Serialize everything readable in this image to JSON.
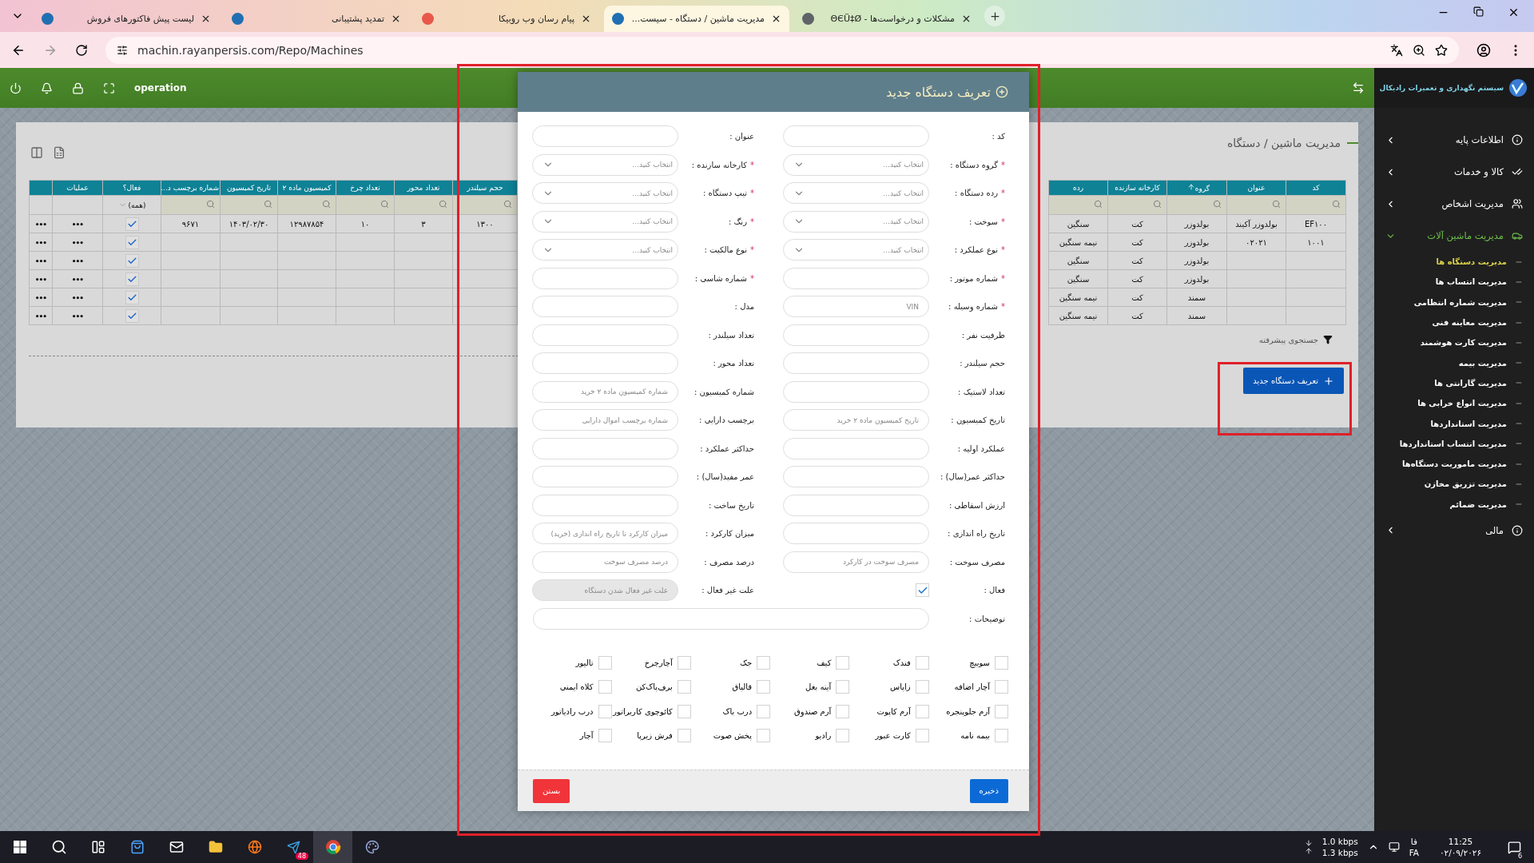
{
  "browser": {
    "tabs": [
      {
        "title": "مشکلات و درخواست‌ها - ΘЄÜ‡Ø",
        "selected": false,
        "color": "#5f6368"
      },
      {
        "title": "مدیریت ماشین / دستگاه - سیست...",
        "selected": true,
        "color": "#1f6fb2"
      },
      {
        "title": "پیام رسان وب روبیکا",
        "selected": false,
        "color": "#e8574a"
      },
      {
        "title": "تمدید پشتیبانی",
        "selected": false,
        "color": "#1f6fb2"
      },
      {
        "title": "لیست پیش فاکتورهای فروش",
        "selected": false,
        "color": "#1f6fb2"
      }
    ],
    "url": "machin.rayanpersis.com/Repo/Machines"
  },
  "header": {
    "user": "operation"
  },
  "sidebar": {
    "title": "سیستم نگهداری و تعمیرات رادیکال",
    "items": [
      {
        "label": "اطلاعات پایه",
        "expanded": false
      },
      {
        "label": "کالا و خدمات",
        "expanded": false
      },
      {
        "label": "مدیریت اشخاص",
        "expanded": false
      },
      {
        "label": "مدیریت ماشین آلات",
        "expanded": true,
        "children": [
          {
            "label": "مدیریت دستگاه ها",
            "selected": true
          },
          {
            "label": "مدیریت انتساب ها",
            "selected": false
          },
          {
            "label": "مدیریت شماره انتظامی",
            "selected": false
          },
          {
            "label": "مدیریت معاینه فنی",
            "selected": false
          },
          {
            "label": "مدیریت کارت هوشمند",
            "selected": false
          },
          {
            "label": "مدیریت بیمه",
            "selected": false
          },
          {
            "label": "مدیریت گارانتی ها",
            "selected": false
          },
          {
            "label": "مدیریت انواع خرابی ها",
            "selected": false
          },
          {
            "label": "مدیریت استانداردها",
            "selected": false
          },
          {
            "label": "مدیریت انتساب استانداردها",
            "selected": false
          },
          {
            "label": "مدیریت ماموریت دستگاه‌ها",
            "selected": false
          },
          {
            "label": "مدیریت تزریق مخازن",
            "selected": false
          },
          {
            "label": "مدیریت ضمائم",
            "selected": false
          }
        ]
      },
      {
        "label": "مالی",
        "expanded": false
      }
    ]
  },
  "page": {
    "breadcrumb": "مدیریت ماشین / دستگاه",
    "advanced_search": "جستجوی پیشرفته",
    "new_button": "تعریف دستگاه جدید"
  },
  "table": {
    "right_columns": [
      {
        "label": "کد",
        "sorted": false
      },
      {
        "label": "عنوان",
        "sorted": false
      },
      {
        "label": "گروه",
        "sorted": true
      },
      {
        "label": "کارخانه سازنده",
        "sorted": false
      },
      {
        "label": "رده",
        "sorted": false
      }
    ],
    "right_rows": [
      [
        "EF۱۰۰",
        "بولدوزر آکیند",
        "بولدوزر",
        "کت",
        "سنگین"
      ],
      [
        "۱۰۰۱",
        "۰۲۰۲۱",
        "بولدوزر",
        "کت",
        "نیمه سنگین"
      ],
      [
        null,
        null,
        "بولدوزر",
        "کت",
        "سنگین"
      ],
      [
        null,
        null,
        "بولدوزر",
        "کت",
        "سنگین"
      ],
      [
        null,
        null,
        "سمند",
        "کت",
        "نیمه سنگین"
      ],
      [
        null,
        null,
        "سمند",
        "کت",
        "نیمه سنگین"
      ]
    ],
    "left_columns": [
      "حجم سیلندر",
      "تعداد محور",
      "تعداد چرخ",
      "کمیسیون ماده ۲",
      "تاریخ کمیسیون",
      "شماره برچسب د..."
    ],
    "active_column": "فعال؟",
    "active_filter": "(همه)",
    "actions_column": "عملیات",
    "left_rows": [
      {
        "cells": [
          "۱۳۰۰",
          "۳",
          "۱۰",
          "۱۲۹۸۷۸۵۴",
          "۱۴۰۳/۰۲/۳۰",
          "۹۶۷۱"
        ],
        "active": true,
        "actions": "•••",
        "menu": "•••"
      },
      {
        "cells": [
          null,
          null,
          null,
          null,
          null,
          null
        ],
        "active": true,
        "actions": "•••",
        "menu": "•••"
      },
      {
        "cells": [
          null,
          null,
          null,
          null,
          null,
          null
        ],
        "active": true,
        "actions": "•••",
        "menu": "•••"
      },
      {
        "cells": [
          null,
          null,
          null,
          null,
          null,
          null
        ],
        "active": true,
        "actions": "•••",
        "menu": "•••"
      },
      {
        "cells": [
          null,
          null,
          null,
          null,
          null,
          null
        ],
        "active": true,
        "actions": "•••",
        "menu": "•••"
      },
      {
        "cells": [
          null,
          null,
          null,
          null,
          null,
          null
        ],
        "active": true,
        "actions": "•••",
        "menu": "•••"
      }
    ]
  },
  "modal": {
    "title": "تعریف دستگاه جدید",
    "fields": [
      {
        "label": "کد :",
        "required": false,
        "kind": "text"
      },
      {
        "label": "عنوان :",
        "required": false,
        "kind": "text"
      },
      {
        "label": "گروه دستگاه :",
        "required": true,
        "kind": "select",
        "placeholder": "انتخاب کنید..."
      },
      {
        "label": "کارخانه سازنده :",
        "required": true,
        "kind": "select",
        "placeholder": "انتخاب کنید..."
      },
      {
        "label": "رده دستگاه :",
        "required": true,
        "kind": "select",
        "placeholder": "انتخاب کنید..."
      },
      {
        "label": "تیپ دستگاه :",
        "required": true,
        "kind": "select",
        "placeholder": "انتخاب کنید..."
      },
      {
        "label": "سوخت :",
        "required": true,
        "kind": "select",
        "placeholder": "انتخاب کنید..."
      },
      {
        "label": "رنگ :",
        "required": true,
        "kind": "select",
        "placeholder": "انتخاب کنید..."
      },
      {
        "label": "نوع عملکرد :",
        "required": true,
        "kind": "select",
        "placeholder": "انتخاب کنید..."
      },
      {
        "label": "نوع مالکیت :",
        "required": true,
        "kind": "select",
        "placeholder": "انتخاب کنید..."
      },
      {
        "label": "شماره موتور :",
        "required": true,
        "kind": "text"
      },
      {
        "label": "شماره شاسی :",
        "required": true,
        "kind": "text"
      },
      {
        "label": "شماره وسیله :",
        "required": true,
        "kind": "text",
        "placeholder": "VIN"
      },
      {
        "label": "مدل :",
        "required": false,
        "kind": "text"
      },
      {
        "label": "ظرفیت نفر :",
        "required": false,
        "kind": "text"
      },
      {
        "label": "تعداد سیلندر :",
        "required": false,
        "kind": "text"
      },
      {
        "label": "حجم سیلندر :",
        "required": false,
        "kind": "text"
      },
      {
        "label": "تعداد محور :",
        "required": false,
        "kind": "text"
      },
      {
        "label": "تعداد لاستیک :",
        "required": false,
        "kind": "text"
      },
      {
        "label": "شماره کمیسیون :",
        "required": false,
        "kind": "text",
        "placeholder": "شماره کمیسیون ماده ۲ خرید"
      },
      {
        "label": "تاریخ کمیسیون :",
        "required": false,
        "kind": "text",
        "placeholder": "تاریخ کمیسیون ماده ۲ خرید"
      },
      {
        "label": "برچسب دارایی :",
        "required": false,
        "kind": "text",
        "placeholder": "شماره برچسب اموال دارایی"
      },
      {
        "label": "عملکرد اولیه :",
        "required": false,
        "kind": "text"
      },
      {
        "label": "حداکثر عملکرد :",
        "required": false,
        "kind": "text"
      },
      {
        "label": "حداکثر عمر(سال) :",
        "required": false,
        "kind": "text"
      },
      {
        "label": "عمر مفید(سال) :",
        "required": false,
        "kind": "text"
      },
      {
        "label": "ارزش اسقاطی :",
        "required": false,
        "kind": "text"
      },
      {
        "label": "تاریخ ساخت :",
        "required": false,
        "kind": "text"
      },
      {
        "label": "تاریخ راه اندازی :",
        "required": false,
        "kind": "text"
      },
      {
        "label": "میزان کارکرد :",
        "required": false,
        "kind": "text",
        "placeholder": "میزان کارکرد تا تاریخ راه اندازی (خرید)"
      },
      {
        "label": "مصرف سوخت :",
        "required": false,
        "kind": "text",
        "placeholder": "مصرف سوخت در کارکرد"
      },
      {
        "label": "درصد مصرف :",
        "required": false,
        "kind": "text",
        "placeholder": "درصد مصرف سوخت"
      },
      {
        "label": "فعال :",
        "required": false,
        "kind": "checkbox",
        "checked": true
      },
      {
        "label": "علت غیر فعال :",
        "required": false,
        "kind": "text",
        "placeholder": "علت غیر فعال شدن دستگاه",
        "disabled": true
      },
      {
        "label": "توضیحات :",
        "required": false,
        "kind": "wide"
      }
    ],
    "accessories": [
      {
        "label": "سوییچ",
        "checked": false
      },
      {
        "label": "فندک",
        "checked": false
      },
      {
        "label": "کیف",
        "checked": false
      },
      {
        "label": "جک",
        "checked": false
      },
      {
        "label": "آچارچرخ",
        "checked": false
      },
      {
        "label": "تالیور",
        "checked": false
      },
      {
        "label": "آچار اضافه",
        "checked": false
      },
      {
        "label": "زاپاس",
        "checked": false
      },
      {
        "label": "آینه بغل",
        "checked": false
      },
      {
        "label": "قالپاق",
        "checked": false
      },
      {
        "label": "برف‌پاک‌کن",
        "checked": false
      },
      {
        "label": "کلاه ایمنی",
        "checked": false
      },
      {
        "label": "آرم جلوپنجره",
        "checked": false
      },
      {
        "label": "آرم کاپوت",
        "checked": false
      },
      {
        "label": "آرم صندوق",
        "checked": false
      },
      {
        "label": "درب باک",
        "checked": false
      },
      {
        "label": "کائوچوی کاربراتور",
        "checked": false
      },
      {
        "label": "درب رادیاتور",
        "checked": false
      },
      {
        "label": "بیمه نامه",
        "checked": false
      },
      {
        "label": "کارت عبور",
        "checked": false
      },
      {
        "label": "رادیو",
        "checked": false
      },
      {
        "label": "پخش صوت",
        "checked": false
      },
      {
        "label": "فرش زیرپا",
        "checked": false
      },
      {
        "label": "آچار",
        "checked": false
      }
    ],
    "required_mark": "*",
    "save": "ذخیره",
    "close": "بستن"
  },
  "taskbar": {
    "telegram_badge": "48",
    "down_speed": "1.0 kbps",
    "up_speed": "1.3 kbps",
    "lang_fa": "فا",
    "lang_code": "FA",
    "time": "11:25",
    "date": "۰۲/۰۹/۲۰۲۶",
    "notifications": "6"
  }
}
